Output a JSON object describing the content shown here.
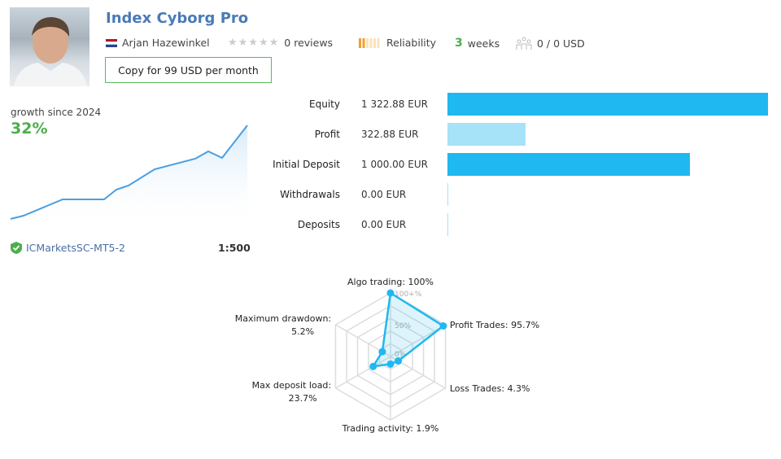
{
  "header": {
    "title": "Index Cyborg Pro",
    "author": "Arjan Hazewinkel",
    "reviews": "0 reviews",
    "rating": 0,
    "reliability_label": "Reliability",
    "reliability_level": 2,
    "age_number": "3",
    "age_unit": "weeks",
    "subscribers": "0 / 0 USD",
    "copy_button": "Copy for 99 USD per month"
  },
  "growth": {
    "label": "growth since 2024",
    "value": "32%",
    "server": "ICMarketsSC-MT5-2",
    "leverage": "1:500"
  },
  "stats": [
    {
      "label": "Equity",
      "value": "1 322.88 EUR",
      "amount": 1322.88,
      "color": "#20b8f0"
    },
    {
      "label": "Profit",
      "value": "322.88 EUR",
      "amount": 322.88,
      "color": "#a6e2f8"
    },
    {
      "label": "Initial Deposit",
      "value": "1 000.00 EUR",
      "amount": 1000,
      "color": "#20b8f0"
    },
    {
      "label": "Withdrawals",
      "value": "0.00 EUR",
      "amount": 0,
      "color": "#20b8f0"
    },
    {
      "label": "Deposits",
      "value": "0.00 EUR",
      "amount": 0,
      "color": "#20b8f0"
    }
  ],
  "radar": {
    "ring_labels": [
      "100+%",
      "50%",
      "0%"
    ],
    "axes": [
      {
        "label": "Algo trading: 100%",
        "value": 100
      },
      {
        "label": "Profit Trades: 95.7%",
        "value": 95.7
      },
      {
        "label": "Loss Trades: 4.3%",
        "value": 4.3
      },
      {
        "label": "Trading activity: 1.9%",
        "value": 1.9
      },
      {
        "label": "Max deposit load:",
        "value2": "23.7%",
        "value": 23.7
      },
      {
        "label": "Maximum drawdown:",
        "value2": "5.2%",
        "value": 5.2
      }
    ]
  },
  "colors": {
    "accent": "#20b8f0",
    "title": "#4a7ab8",
    "green": "#4cae4c"
  }
}
